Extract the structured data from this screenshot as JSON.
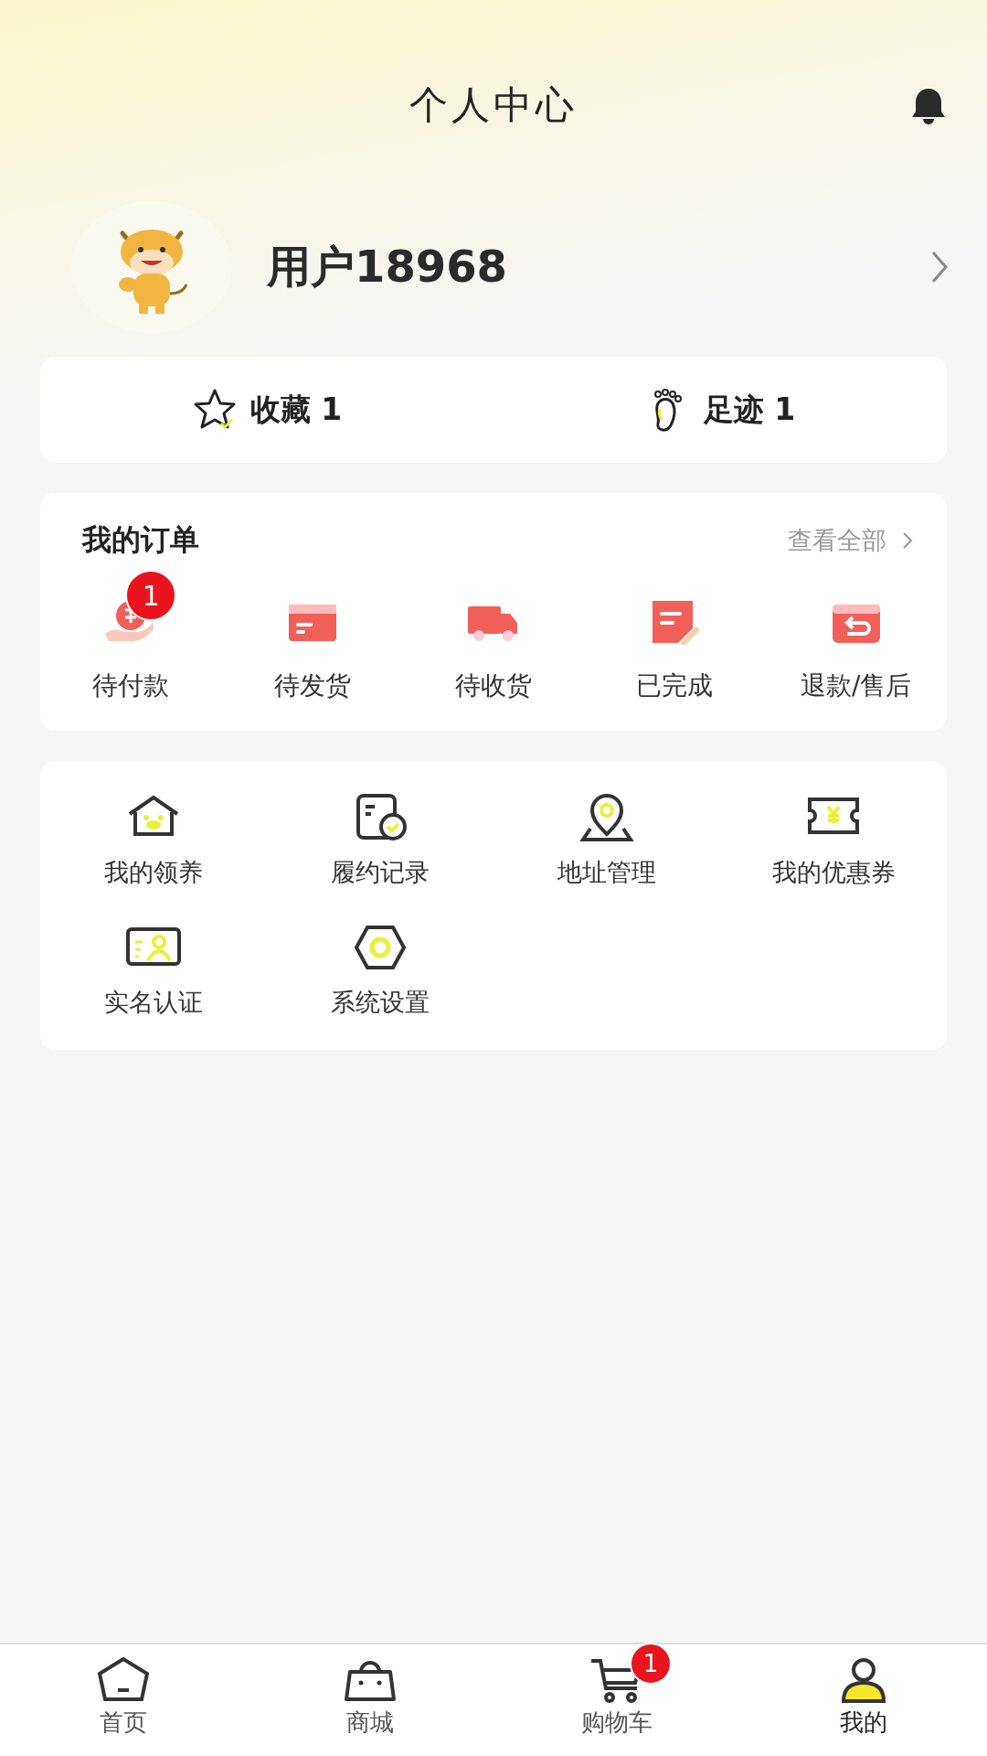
{
  "header": {
    "title": "个人中心"
  },
  "profile": {
    "username": "用户18968"
  },
  "stats": [
    {
      "label": "收藏 1"
    },
    {
      "label": "足迹 1"
    }
  ],
  "orders": {
    "title": "我的订单",
    "view_all": "查看全部",
    "items": [
      {
        "label": "待付款",
        "badge": "1"
      },
      {
        "label": "待发货"
      },
      {
        "label": "待收货"
      },
      {
        "label": "已完成"
      },
      {
        "label": "退款/售后"
      }
    ]
  },
  "services": [
    {
      "label": "我的领养"
    },
    {
      "label": "履约记录"
    },
    {
      "label": "地址管理"
    },
    {
      "label": "我的优惠券"
    },
    {
      "label": "实名认证"
    },
    {
      "label": "系统设置"
    }
  ],
  "tab_bar": [
    {
      "label": "首页",
      "selected": false
    },
    {
      "label": "商城",
      "selected": false
    },
    {
      "label": "购物车",
      "selected": false,
      "badge": "1"
    },
    {
      "label": "我的",
      "selected": true
    }
  ]
}
